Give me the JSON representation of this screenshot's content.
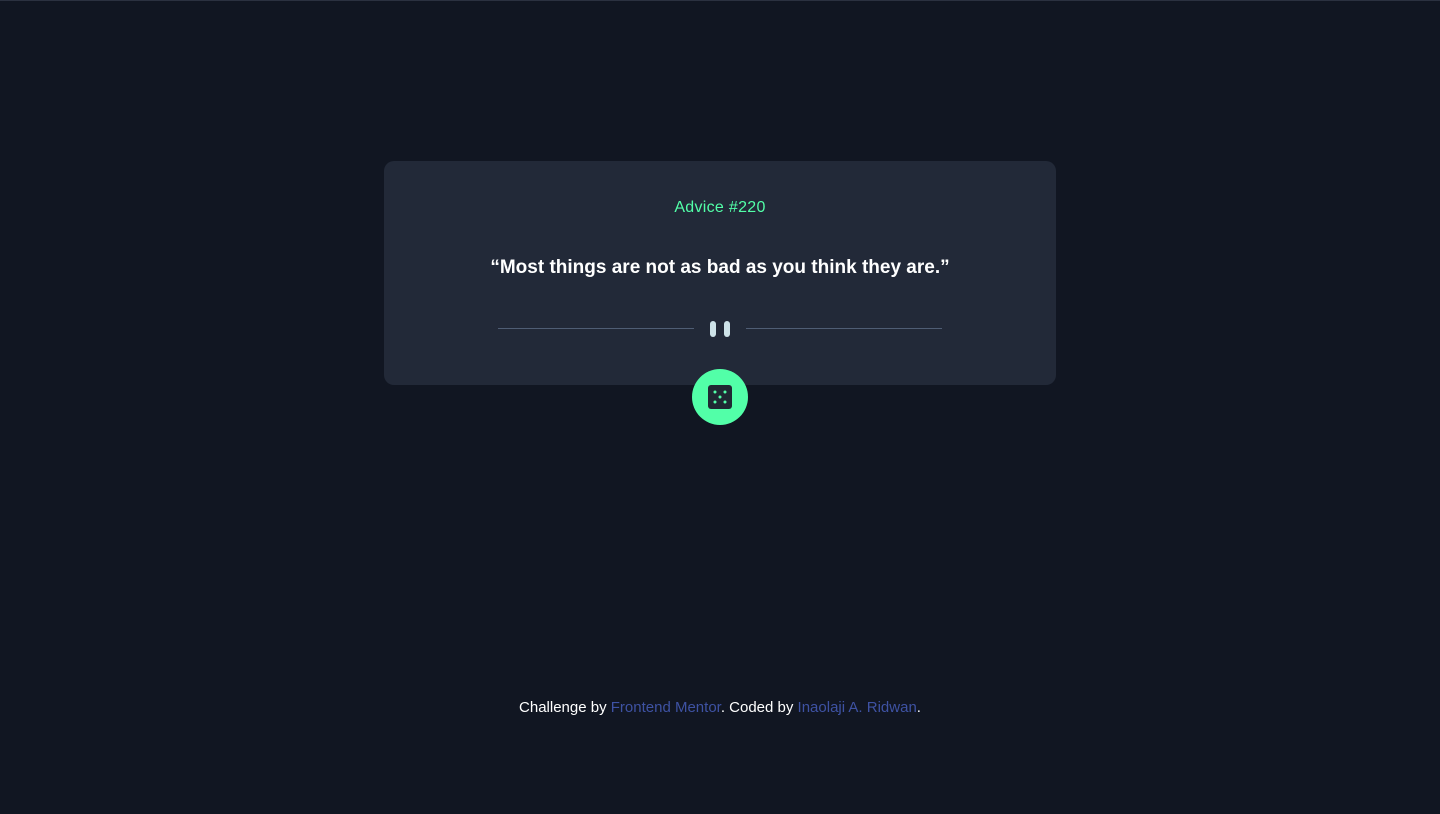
{
  "card": {
    "advice_label": "Advice #220",
    "quote": "“Most things are not as bad as you think they are.”"
  },
  "icons": {
    "divider": "pause-icon",
    "dice": "dice-icon"
  },
  "footer": {
    "prefix": "Challenge by ",
    "link1": "Frontend Mentor",
    "middle": ". Coded by ",
    "link2": "Inaolaji A. Ridwan",
    "suffix": "."
  },
  "colors": {
    "background": "#111622",
    "card": "#222938",
    "accent": "#52ffa8",
    "divider": "#4f5d74",
    "link": "#3e52a3"
  }
}
